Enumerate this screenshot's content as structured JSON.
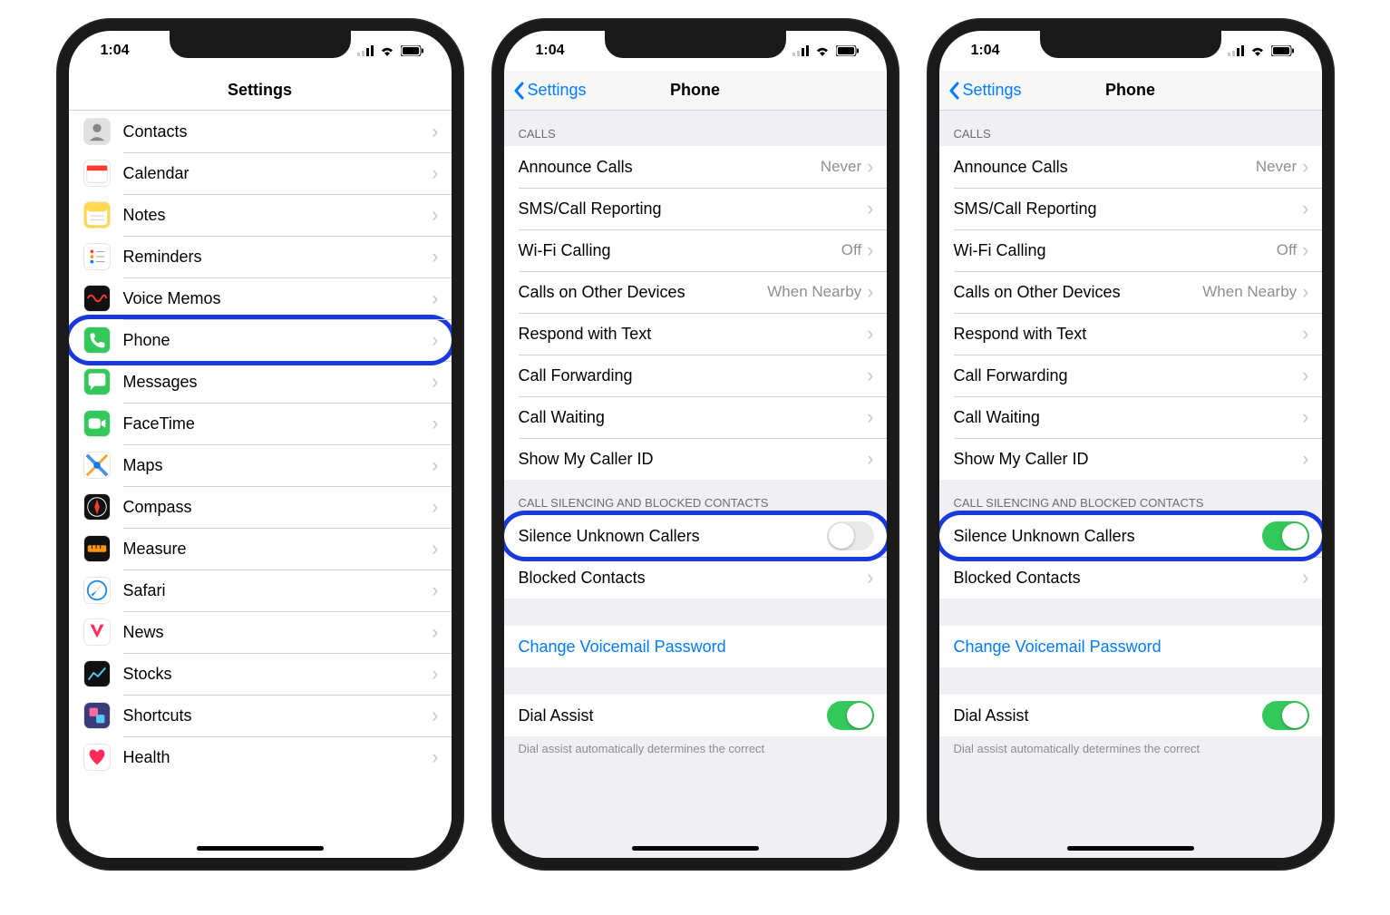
{
  "status": {
    "time": "1:04"
  },
  "screen1": {
    "title": "Settings",
    "items": [
      {
        "name": "Contacts",
        "icon_bg": "#e0e0e0"
      },
      {
        "name": "Calendar",
        "icon_bg": "#ffffff"
      },
      {
        "name": "Notes",
        "icon_bg": "#ffd84c"
      },
      {
        "name": "Reminders",
        "icon_bg": "#ffffff"
      },
      {
        "name": "Voice Memos",
        "icon_bg": "#111111"
      },
      {
        "name": "Phone",
        "icon_bg": "#34c759",
        "highlight": true
      },
      {
        "name": "Messages",
        "icon_bg": "#34c759"
      },
      {
        "name": "FaceTime",
        "icon_bg": "#34c759"
      },
      {
        "name": "Maps",
        "icon_bg": "#ffffff"
      },
      {
        "name": "Compass",
        "icon_bg": "#111111"
      },
      {
        "name": "Measure",
        "icon_bg": "#111111"
      },
      {
        "name": "Safari",
        "icon_bg": "#ffffff"
      },
      {
        "name": "News",
        "icon_bg": "#ffffff"
      },
      {
        "name": "Stocks",
        "icon_bg": "#111111"
      },
      {
        "name": "Shortcuts",
        "icon_bg": "#3b3b7a"
      },
      {
        "name": "Health",
        "icon_bg": "#ffffff"
      }
    ]
  },
  "screen2": {
    "back": "Settings",
    "title": "Phone",
    "silence_toggle": false
  },
  "screen3": {
    "back": "Settings",
    "title": "Phone",
    "silence_toggle": true
  },
  "phone_page": {
    "sections": {
      "calls_header": "CALLS",
      "calls": [
        {
          "label": "Announce Calls",
          "value": "Never"
        },
        {
          "label": "SMS/Call Reporting",
          "value": ""
        },
        {
          "label": "Wi-Fi Calling",
          "value": "Off"
        },
        {
          "label": "Calls on Other Devices",
          "value": "When Nearby"
        },
        {
          "label": "Respond with Text",
          "value": ""
        },
        {
          "label": "Call Forwarding",
          "value": ""
        },
        {
          "label": "Call Waiting",
          "value": ""
        },
        {
          "label": "Show My Caller ID",
          "value": ""
        }
      ],
      "silencing_header": "CALL SILENCING AND BLOCKED CONTACTS",
      "silence_label": "Silence Unknown Callers",
      "blocked_label": "Blocked Contacts",
      "change_vm": "Change Voicemail Password",
      "dial_assist_label": "Dial Assist",
      "dial_assist_on": true,
      "dial_footer": "Dial assist automatically determines the correct"
    }
  }
}
